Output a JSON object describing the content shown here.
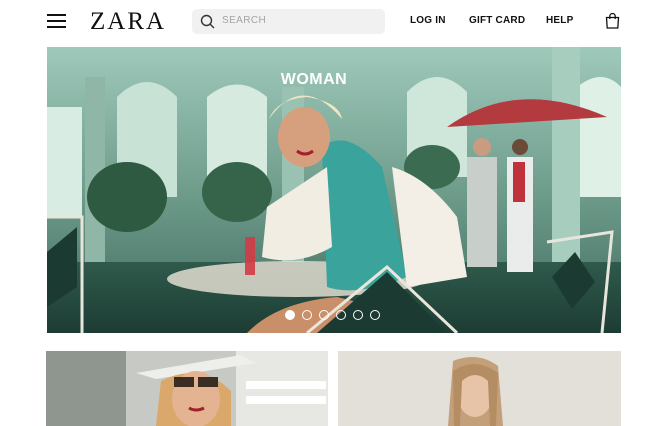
{
  "header": {
    "logo": "ZARA",
    "search_placeholder": "SEARCH",
    "nav": [
      {
        "label": "LOG IN"
      },
      {
        "label": "GIFT CARD"
      },
      {
        "label": "HELP"
      }
    ],
    "icons": {
      "menu": "hamburger-menu-icon",
      "search": "search-icon",
      "bag": "shopping-bag-icon"
    }
  },
  "hero": {
    "title": "WOMAN",
    "carousel": {
      "total_slides": 6,
      "active_slide": 1
    }
  },
  "cards": [
    {
      "name": "left-promo-image"
    },
    {
      "name": "right-promo-image"
    }
  ]
}
